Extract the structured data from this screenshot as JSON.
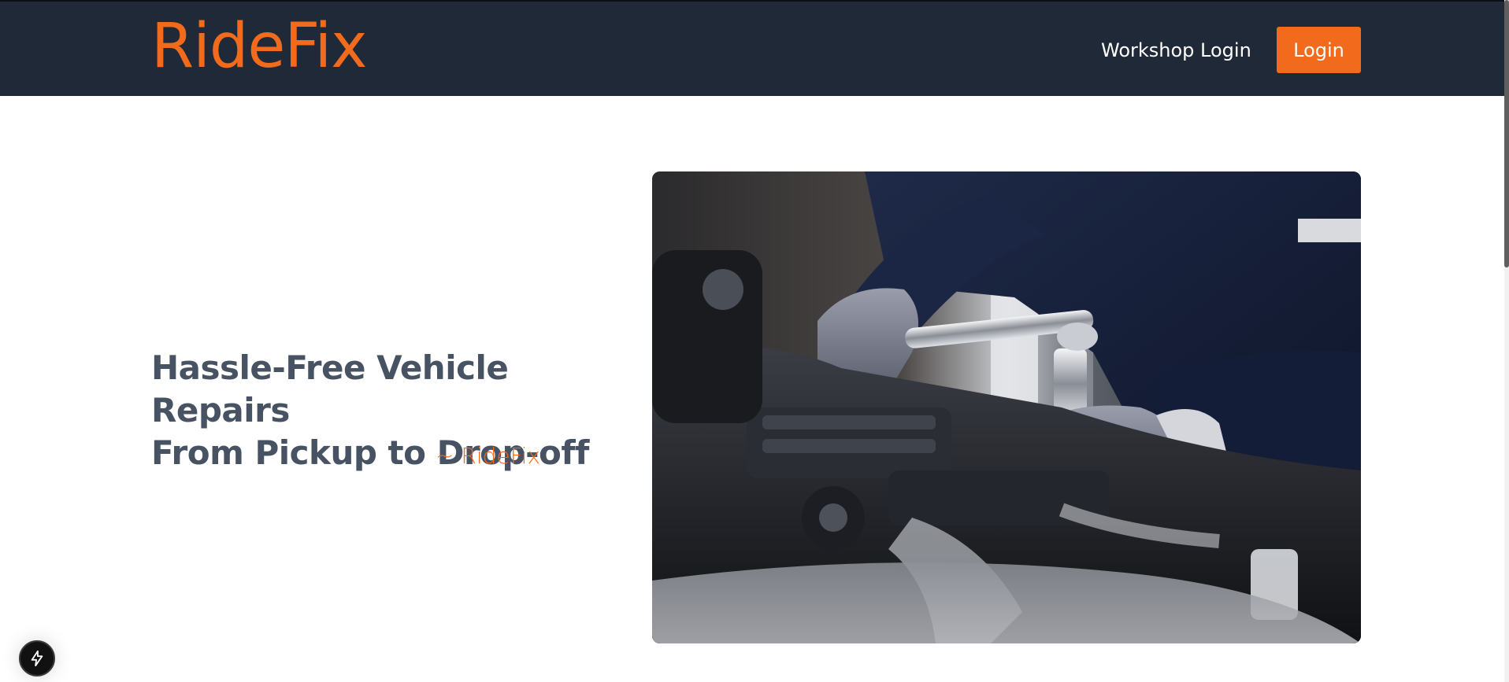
{
  "header": {
    "brand": "RideFix",
    "workshop_login_label": "Workshop Login",
    "login_label": "Login"
  },
  "hero": {
    "headline_line1": "Hassle-Free Vehicle Repairs",
    "headline_line2": "From Pickup to Drop-off",
    "signature": "~ RideFix",
    "image_subject": "mechanic-repairing-car-engine"
  },
  "floating": {
    "icon": "lightning-bolt-icon"
  },
  "colors": {
    "header_bg": "#1f2937",
    "accent": "#f26a1b",
    "headline": "#475263",
    "page_bg": "#ffffff"
  }
}
